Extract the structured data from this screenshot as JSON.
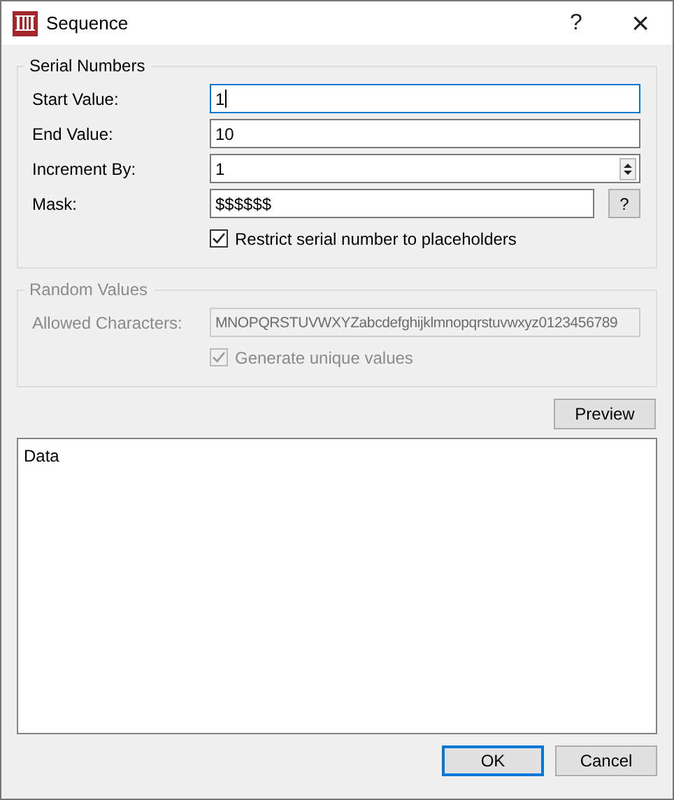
{
  "window": {
    "title": "Sequence",
    "help_button": "?",
    "close_button": "×"
  },
  "serial_numbers": {
    "title": "Serial Numbers",
    "disabled": false,
    "fields": [
      {
        "kind": "text",
        "label": "Start Value:",
        "value": "1",
        "focused": true
      },
      {
        "kind": "text",
        "label": "End Value:",
        "value": "10",
        "focused": false
      },
      {
        "kind": "spin",
        "label": "Increment By:",
        "value": "1",
        "focused": false
      },
      {
        "kind": "help",
        "label": "Mask:",
        "value": "$$$$$$",
        "focused": false,
        "button": "?"
      }
    ],
    "checkbox": {
      "label": "Restrict serial number to placeholders",
      "checked": true,
      "disabled": false
    }
  },
  "random_values": {
    "title": "Random Values",
    "disabled": true,
    "fields": [
      {
        "kind": "text",
        "label": "Allowed Characters:",
        "value": "MNOPQRSTUVWXYZabcdefghijklmnopqrstuvwxyz0123456789",
        "focused": false
      }
    ],
    "checkbox": {
      "label": "Generate unique values",
      "checked": true,
      "disabled": true
    }
  },
  "preview_button": "Preview",
  "data_area": {
    "text": "Data"
  },
  "buttons": [
    {
      "label": "OK",
      "default": true
    },
    {
      "label": "Cancel",
      "default": false
    }
  ]
}
